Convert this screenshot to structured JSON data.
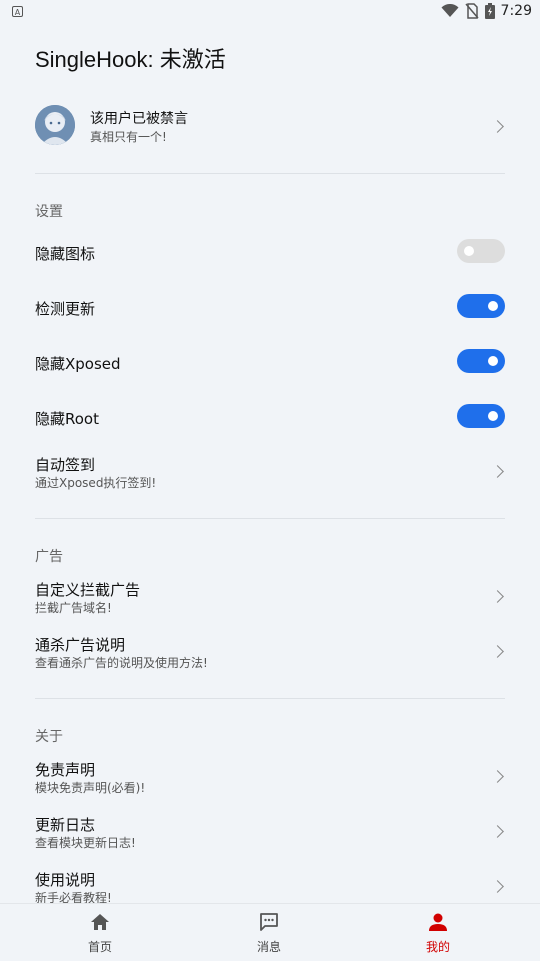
{
  "status_bar": {
    "time": "7:29"
  },
  "title": "SingleHook: 未激活",
  "user": {
    "name": "该用户已被禁言",
    "motto": "真相只有一个!"
  },
  "sections": {
    "settings": {
      "title": "设置",
      "hide_icon": {
        "label": "隐藏图标",
        "enabled": false
      },
      "check_update": {
        "label": "检测更新",
        "enabled": true
      },
      "hide_xposed": {
        "label": "隐藏Xposed",
        "enabled": true
      },
      "hide_root": {
        "label": "隐藏Root",
        "enabled": true
      },
      "auto_sign": {
        "label": "自动签到",
        "sub": "通过Xposed执行签到!"
      }
    },
    "ads": {
      "title": "广告",
      "custom_block": {
        "label": "自定义拦截广告",
        "sub": "拦截广告域名!"
      },
      "kill_all": {
        "label": "通杀广告说明",
        "sub": "查看通杀广告的说明及使用方法!"
      }
    },
    "about": {
      "title": "关于",
      "disclaimer": {
        "label": "免责声明",
        "sub": "模块免责声明(必看)!"
      },
      "changelog": {
        "label": "更新日志",
        "sub": "查看模块更新日志!"
      },
      "usage": {
        "label": "使用说明",
        "sub": "新手必看教程!"
      }
    }
  },
  "bottom_nav": {
    "home": "首页",
    "messages": "消息",
    "mine": "我的",
    "active": "mine"
  },
  "colors": {
    "accent": "#1f6feb",
    "active_nav": "#d10000",
    "background": "#f1f4f8"
  }
}
